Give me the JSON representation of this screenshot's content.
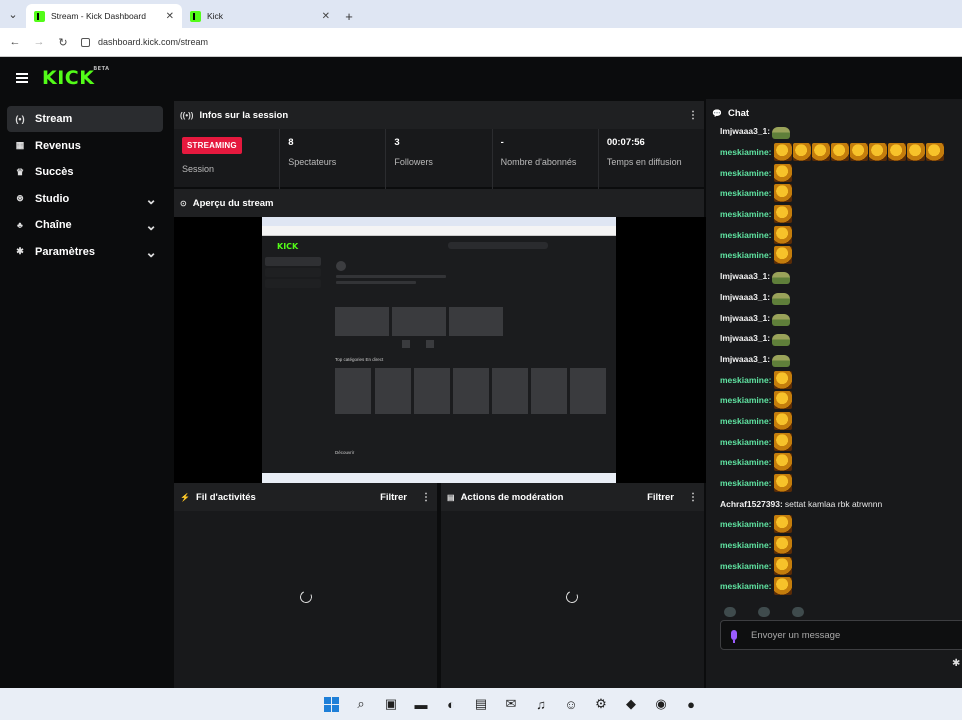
{
  "browser": {
    "tabs": [
      {
        "title": "Stream - Kick Dashboard",
        "active": true
      },
      {
        "title": "Kick",
        "active": false
      }
    ],
    "url": "dashboard.kick.com/stream"
  },
  "app": {
    "logo": "KICK",
    "logo_badge": "BETA"
  },
  "sidebar": {
    "items": [
      {
        "label": "Stream",
        "icon": "broadcast-icon",
        "glyph": "(•)",
        "active": true,
        "expandable": false
      },
      {
        "label": "Revenus",
        "icon": "chart-icon",
        "glyph": "▦",
        "active": false,
        "expandable": false
      },
      {
        "label": "Succès",
        "icon": "trophy-icon",
        "glyph": "♛",
        "active": false,
        "expandable": false
      },
      {
        "label": "Studio",
        "icon": "studio-icon",
        "glyph": "⊛",
        "active": false,
        "expandable": true
      },
      {
        "label": "Chaîne",
        "icon": "users-icon",
        "glyph": "♣",
        "active": false,
        "expandable": true
      },
      {
        "label": "Paramètres",
        "icon": "gear-icon",
        "glyph": "✱",
        "active": false,
        "expandable": true
      }
    ]
  },
  "session": {
    "title": "Infos sur la session",
    "status_badge": "STREAMING",
    "status_label": "Session",
    "viewers_value": "8",
    "viewers_label": "Spectateurs",
    "followers_value": "3",
    "followers_label": "Followers",
    "subs_value": "-",
    "subs_label": "Nombre d'abonnés",
    "duration_value": "00:07:56",
    "duration_label": "Temps en diffusion"
  },
  "preview": {
    "title": "Aperçu du stream",
    "thumb_logo": "KICK",
    "thumb_categories": "Top catégories En direct",
    "thumb_discover": "Découvrir"
  },
  "activity": {
    "title": "Fil d'activités",
    "filter": "Filtrer"
  },
  "moderation": {
    "title": "Actions de modération",
    "filter": "Filtrer"
  },
  "chat": {
    "title": "Chat",
    "input_placeholder": "Envoyer un message",
    "colors": {
      "green_user": "#5fe3a1",
      "white_user": "#f2f2f2"
    },
    "messages": [
      {
        "user": "lmjwaaa3_1:",
        "color": "white",
        "emotes": [
          "frog"
        ],
        "text": ""
      },
      {
        "user": "meskiamine:",
        "color": "green",
        "emotes": [
          "gold",
          "gold",
          "gold",
          "gold",
          "gold",
          "gold",
          "gold",
          "gold",
          "gold"
        ],
        "text": ""
      },
      {
        "user": "meskiamine:",
        "color": "green",
        "emotes": [
          "gold"
        ],
        "text": ""
      },
      {
        "user": "meskiamine:",
        "color": "green",
        "emotes": [
          "gold"
        ],
        "text": ""
      },
      {
        "user": "meskiamine:",
        "color": "green",
        "emotes": [
          "gold"
        ],
        "text": ""
      },
      {
        "user": "meskiamine:",
        "color": "green",
        "emotes": [
          "gold"
        ],
        "text": ""
      },
      {
        "user": "meskiamine:",
        "color": "green",
        "emotes": [
          "gold"
        ],
        "text": ""
      },
      {
        "user": "lmjwaaa3_1:",
        "color": "white",
        "emotes": [
          "frog"
        ],
        "text": ""
      },
      {
        "user": "lmjwaaa3_1:",
        "color": "white",
        "emotes": [
          "frog"
        ],
        "text": ""
      },
      {
        "user": "lmjwaaa3_1:",
        "color": "white",
        "emotes": [
          "frog"
        ],
        "text": ""
      },
      {
        "user": "lmjwaaa3_1:",
        "color": "white",
        "emotes": [
          "frog"
        ],
        "text": ""
      },
      {
        "user": "lmjwaaa3_1:",
        "color": "white",
        "emotes": [
          "frog"
        ],
        "text": ""
      },
      {
        "user": "meskiamine:",
        "color": "green",
        "emotes": [
          "gold"
        ],
        "text": ""
      },
      {
        "user": "meskiamine:",
        "color": "green",
        "emotes": [
          "gold"
        ],
        "text": ""
      },
      {
        "user": "meskiamine:",
        "color": "green",
        "emotes": [
          "gold"
        ],
        "text": ""
      },
      {
        "user": "meskiamine:",
        "color": "green",
        "emotes": [
          "gold"
        ],
        "text": ""
      },
      {
        "user": "meskiamine:",
        "color": "green",
        "emotes": [
          "gold"
        ],
        "text": ""
      },
      {
        "user": "meskiamine:",
        "color": "green",
        "emotes": [
          "gold"
        ],
        "text": ""
      },
      {
        "user": "Achraf1527393:",
        "color": "white",
        "emotes": [],
        "text": "settat kamlaa rbk atrwnnn"
      },
      {
        "user": "meskiamine:",
        "color": "green",
        "emotes": [
          "gold"
        ],
        "text": ""
      },
      {
        "user": "meskiamine:",
        "color": "green",
        "emotes": [
          "gold"
        ],
        "text": ""
      },
      {
        "user": "meskiamine:",
        "color": "green",
        "emotes": [
          "gold"
        ],
        "text": ""
      },
      {
        "user": "meskiamine:",
        "color": "green",
        "emotes": [
          "gold"
        ],
        "text": ""
      }
    ]
  },
  "taskbar": {
    "icons": [
      {
        "name": "windows-start-icon",
        "glyph": ""
      },
      {
        "name": "search-icon",
        "glyph": "⌕"
      },
      {
        "name": "task-view-icon",
        "glyph": "▣"
      },
      {
        "name": "file-explorer-icon",
        "glyph": "▬"
      },
      {
        "name": "edge-icon",
        "glyph": "◐"
      },
      {
        "name": "store-icon",
        "glyph": "▤"
      },
      {
        "name": "outlook-icon",
        "glyph": "✉"
      },
      {
        "name": "spotify-icon",
        "glyph": "♫"
      },
      {
        "name": "discord-icon",
        "glyph": "☺"
      },
      {
        "name": "steam-icon",
        "glyph": "⚙"
      },
      {
        "name": "epic-icon",
        "glyph": "◆"
      },
      {
        "name": "chrome-icon",
        "glyph": "◉"
      },
      {
        "name": "obs-icon",
        "glyph": "●"
      }
    ]
  }
}
